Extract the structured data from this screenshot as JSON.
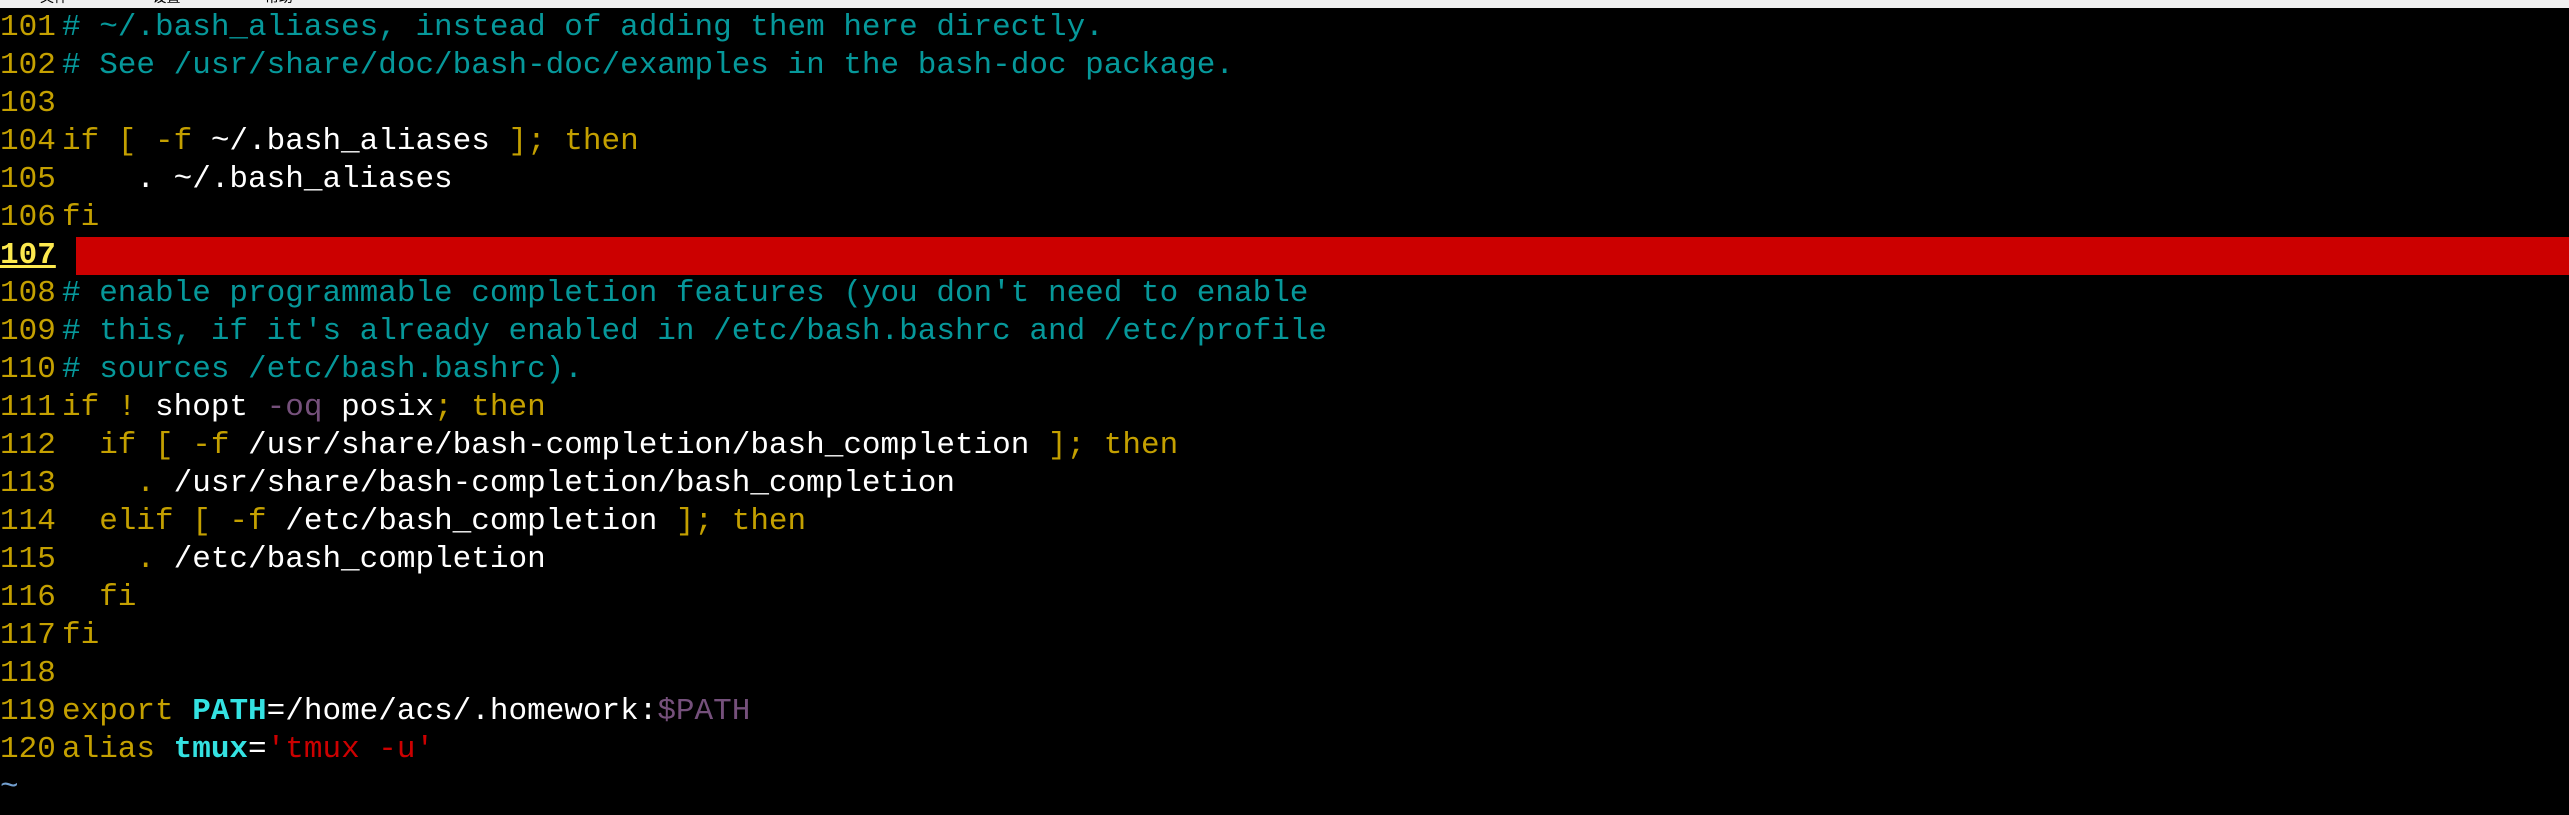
{
  "menubar": {
    "items": [
      "文件",
      "设置",
      "帮助"
    ]
  },
  "colors": {
    "background": "#000000",
    "line_number": "#c4a000",
    "comment": "#06989a",
    "keyword": "#c4a000",
    "current_line_bg": "#cc0000",
    "identifier": "#34e2e2",
    "variable": "#75507b",
    "string": "#cc0000",
    "tilde": "#729fcf"
  },
  "editor": {
    "current_line": "107",
    "tilde": "~",
    "lines": [
      {
        "num": "101",
        "tokens": [
          {
            "t": "comment",
            "v": "# ~/.bash_aliases, instead of adding them here directly."
          }
        ]
      },
      {
        "num": "102",
        "tokens": [
          {
            "t": "comment",
            "v": "# See /usr/share/doc/bash-doc/examples in the bash-doc package."
          }
        ]
      },
      {
        "num": "103",
        "tokens": []
      },
      {
        "num": "104",
        "tokens": [
          {
            "t": "keyword",
            "v": "if [ -f "
          },
          {
            "t": "text",
            "v": "~/.bash_aliases "
          },
          {
            "t": "keyword",
            "v": "]; then"
          }
        ]
      },
      {
        "num": "105",
        "tokens": [
          {
            "t": "text",
            "v": "    . ~/.bash_aliases"
          }
        ]
      },
      {
        "num": "106",
        "tokens": [
          {
            "t": "keyword",
            "v": "fi"
          }
        ]
      },
      {
        "num": "107",
        "tokens": [],
        "current": true
      },
      {
        "num": "108",
        "tokens": [
          {
            "t": "comment",
            "v": "# enable programmable completion features (you don't need to enable"
          }
        ]
      },
      {
        "num": "109",
        "tokens": [
          {
            "t": "comment",
            "v": "# this, if it's already enabled in /etc/bash.bashrc and /etc/profile"
          }
        ]
      },
      {
        "num": "110",
        "tokens": [
          {
            "t": "comment",
            "v": "# sources /etc/bash.bashrc)."
          }
        ]
      },
      {
        "num": "111",
        "tokens": [
          {
            "t": "keyword",
            "v": "if ! "
          },
          {
            "t": "text",
            "v": "shopt "
          },
          {
            "t": "var",
            "v": "-oq "
          },
          {
            "t": "text",
            "v": "posix"
          },
          {
            "t": "keyword",
            "v": "; then"
          }
        ]
      },
      {
        "num": "112",
        "tokens": [
          {
            "t": "keyword",
            "v": "  if [ -f "
          },
          {
            "t": "text",
            "v": "/usr/share/bash-completion/bash_completion "
          },
          {
            "t": "keyword",
            "v": "]; then"
          }
        ]
      },
      {
        "num": "113",
        "tokens": [
          {
            "t": "keyword",
            "v": "    . "
          },
          {
            "t": "text",
            "v": "/usr/share/bash-completion/bash_completion"
          }
        ]
      },
      {
        "num": "114",
        "tokens": [
          {
            "t": "keyword",
            "v": "  elif [ -f "
          },
          {
            "t": "text",
            "v": "/etc/bash_completion "
          },
          {
            "t": "keyword",
            "v": "]; then"
          }
        ]
      },
      {
        "num": "115",
        "tokens": [
          {
            "t": "keyword",
            "v": "    . "
          },
          {
            "t": "text",
            "v": "/etc/bash_completion"
          }
        ]
      },
      {
        "num": "116",
        "tokens": [
          {
            "t": "keyword",
            "v": "  fi"
          }
        ]
      },
      {
        "num": "117",
        "tokens": [
          {
            "t": "keyword",
            "v": "fi"
          }
        ]
      },
      {
        "num": "118",
        "tokens": []
      },
      {
        "num": "119",
        "tokens": [
          {
            "t": "keyword",
            "v": "export "
          },
          {
            "t": "ident",
            "v": "PATH"
          },
          {
            "t": "op",
            "v": "=/home/acs/.homework:"
          },
          {
            "t": "var",
            "v": "$PATH"
          }
        ]
      },
      {
        "num": "120",
        "tokens": [
          {
            "t": "keyword",
            "v": "alias "
          },
          {
            "t": "ident",
            "v": "tmux"
          },
          {
            "t": "op",
            "v": "="
          },
          {
            "t": "string",
            "v": "'tmux -u'"
          }
        ]
      }
    ]
  }
}
